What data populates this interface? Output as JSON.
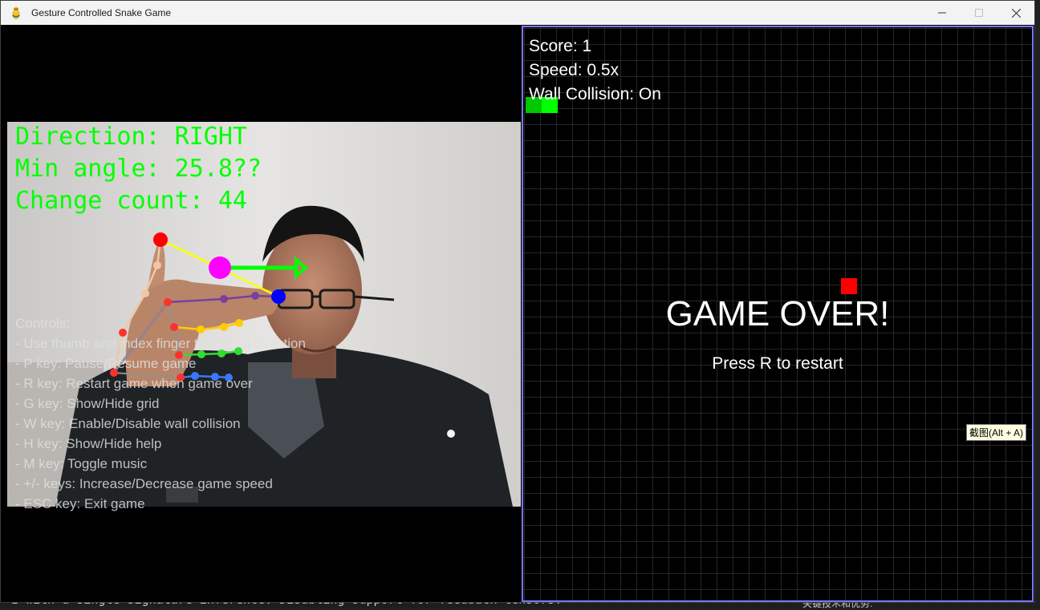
{
  "window": {
    "title": "Gesture Controlled Snake Game"
  },
  "background": {
    "console_line": "I with a single signature inference. Disabling support for feedback tensors.",
    "right_text": "关键技术和优势:"
  },
  "camera": {
    "direction_text": "Direction: RIGHT",
    "min_angle_text": "Min angle: 25.8??",
    "change_count_text": "Change count: 44",
    "help": {
      "title": "Controls:",
      "items": [
        "- Use thumb and index finger to control direction",
        "- P key: Pause/Resume game",
        "- R key: Restart game when game over",
        "- G key: Show/Hide grid",
        "- W key: Enable/Disable wall collision",
        "- H key: Show/Hide help",
        "- M key: Toggle music",
        "- +/- keys: Increase/Decrease game speed",
        "- ESC key: Exit game"
      ]
    }
  },
  "game": {
    "score_text": "Score: 1",
    "speed_text": "Speed: 0.5x",
    "wall_text": "Wall Collision: On",
    "game_over_text": "GAME OVER!",
    "restart_text": "Press R to restart"
  },
  "tooltip": {
    "text": "截图(Alt + A)"
  },
  "colors": {
    "overlay_text": "#00ff00",
    "game_border": "#7878ff",
    "snake": "#00c800",
    "food": "#ff0000"
  },
  "icons": {
    "app": "pygame-snake-icon",
    "minimize": "minimize-icon",
    "maximize": "maximize-icon",
    "close": "close-icon"
  }
}
